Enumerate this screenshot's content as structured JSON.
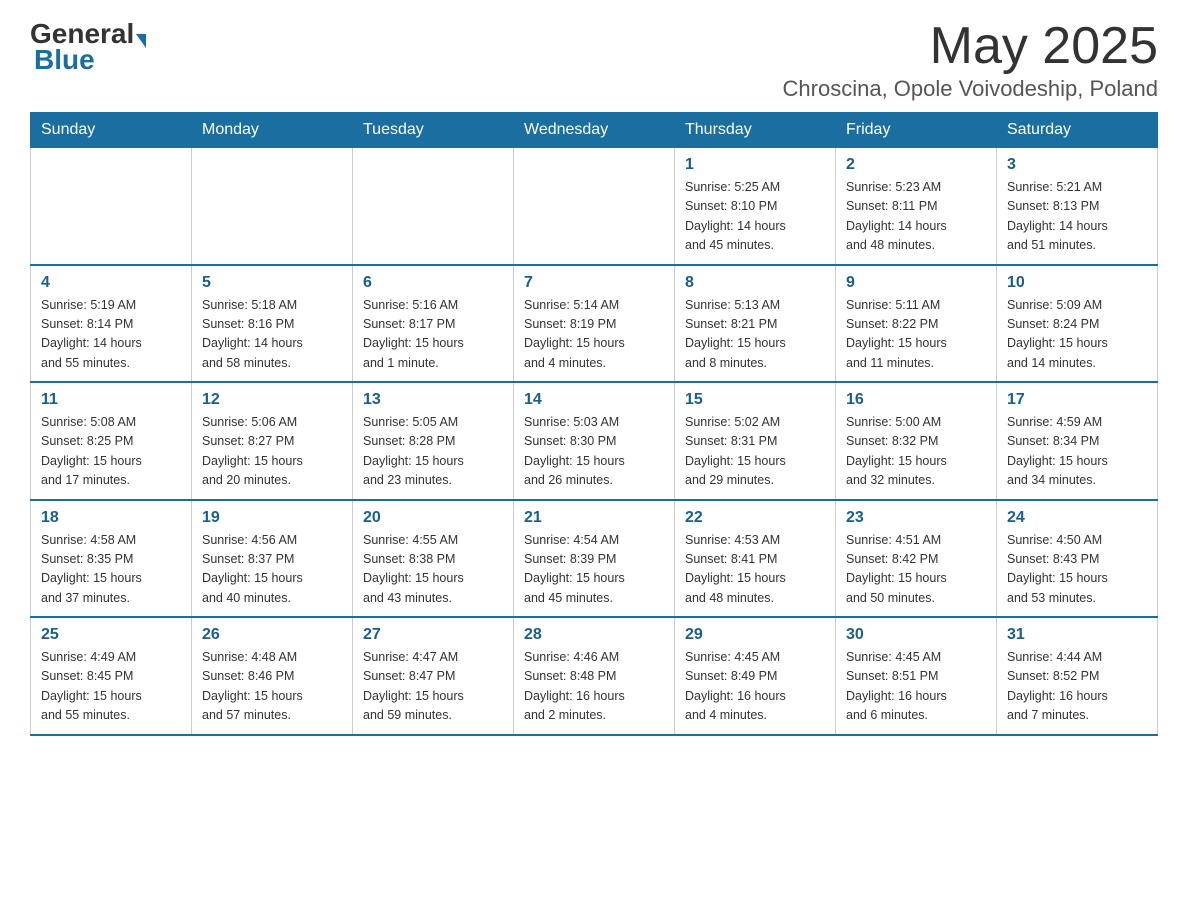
{
  "header": {
    "logo_general": "General",
    "logo_blue": "Blue",
    "month": "May 2025",
    "location": "Chroscina, Opole Voivodeship, Poland"
  },
  "days_of_week": [
    "Sunday",
    "Monday",
    "Tuesday",
    "Wednesday",
    "Thursday",
    "Friday",
    "Saturday"
  ],
  "weeks": [
    [
      {
        "day": "",
        "info": ""
      },
      {
        "day": "",
        "info": ""
      },
      {
        "day": "",
        "info": ""
      },
      {
        "day": "",
        "info": ""
      },
      {
        "day": "1",
        "info": "Sunrise: 5:25 AM\nSunset: 8:10 PM\nDaylight: 14 hours\nand 45 minutes."
      },
      {
        "day": "2",
        "info": "Sunrise: 5:23 AM\nSunset: 8:11 PM\nDaylight: 14 hours\nand 48 minutes."
      },
      {
        "day": "3",
        "info": "Sunrise: 5:21 AM\nSunset: 8:13 PM\nDaylight: 14 hours\nand 51 minutes."
      }
    ],
    [
      {
        "day": "4",
        "info": "Sunrise: 5:19 AM\nSunset: 8:14 PM\nDaylight: 14 hours\nand 55 minutes."
      },
      {
        "day": "5",
        "info": "Sunrise: 5:18 AM\nSunset: 8:16 PM\nDaylight: 14 hours\nand 58 minutes."
      },
      {
        "day": "6",
        "info": "Sunrise: 5:16 AM\nSunset: 8:17 PM\nDaylight: 15 hours\nand 1 minute."
      },
      {
        "day": "7",
        "info": "Sunrise: 5:14 AM\nSunset: 8:19 PM\nDaylight: 15 hours\nand 4 minutes."
      },
      {
        "day": "8",
        "info": "Sunrise: 5:13 AM\nSunset: 8:21 PM\nDaylight: 15 hours\nand 8 minutes."
      },
      {
        "day": "9",
        "info": "Sunrise: 5:11 AM\nSunset: 8:22 PM\nDaylight: 15 hours\nand 11 minutes."
      },
      {
        "day": "10",
        "info": "Sunrise: 5:09 AM\nSunset: 8:24 PM\nDaylight: 15 hours\nand 14 minutes."
      }
    ],
    [
      {
        "day": "11",
        "info": "Sunrise: 5:08 AM\nSunset: 8:25 PM\nDaylight: 15 hours\nand 17 minutes."
      },
      {
        "day": "12",
        "info": "Sunrise: 5:06 AM\nSunset: 8:27 PM\nDaylight: 15 hours\nand 20 minutes."
      },
      {
        "day": "13",
        "info": "Sunrise: 5:05 AM\nSunset: 8:28 PM\nDaylight: 15 hours\nand 23 minutes."
      },
      {
        "day": "14",
        "info": "Sunrise: 5:03 AM\nSunset: 8:30 PM\nDaylight: 15 hours\nand 26 minutes."
      },
      {
        "day": "15",
        "info": "Sunrise: 5:02 AM\nSunset: 8:31 PM\nDaylight: 15 hours\nand 29 minutes."
      },
      {
        "day": "16",
        "info": "Sunrise: 5:00 AM\nSunset: 8:32 PM\nDaylight: 15 hours\nand 32 minutes."
      },
      {
        "day": "17",
        "info": "Sunrise: 4:59 AM\nSunset: 8:34 PM\nDaylight: 15 hours\nand 34 minutes."
      }
    ],
    [
      {
        "day": "18",
        "info": "Sunrise: 4:58 AM\nSunset: 8:35 PM\nDaylight: 15 hours\nand 37 minutes."
      },
      {
        "day": "19",
        "info": "Sunrise: 4:56 AM\nSunset: 8:37 PM\nDaylight: 15 hours\nand 40 minutes."
      },
      {
        "day": "20",
        "info": "Sunrise: 4:55 AM\nSunset: 8:38 PM\nDaylight: 15 hours\nand 43 minutes."
      },
      {
        "day": "21",
        "info": "Sunrise: 4:54 AM\nSunset: 8:39 PM\nDaylight: 15 hours\nand 45 minutes."
      },
      {
        "day": "22",
        "info": "Sunrise: 4:53 AM\nSunset: 8:41 PM\nDaylight: 15 hours\nand 48 minutes."
      },
      {
        "day": "23",
        "info": "Sunrise: 4:51 AM\nSunset: 8:42 PM\nDaylight: 15 hours\nand 50 minutes."
      },
      {
        "day": "24",
        "info": "Sunrise: 4:50 AM\nSunset: 8:43 PM\nDaylight: 15 hours\nand 53 minutes."
      }
    ],
    [
      {
        "day": "25",
        "info": "Sunrise: 4:49 AM\nSunset: 8:45 PM\nDaylight: 15 hours\nand 55 minutes."
      },
      {
        "day": "26",
        "info": "Sunrise: 4:48 AM\nSunset: 8:46 PM\nDaylight: 15 hours\nand 57 minutes."
      },
      {
        "day": "27",
        "info": "Sunrise: 4:47 AM\nSunset: 8:47 PM\nDaylight: 15 hours\nand 59 minutes."
      },
      {
        "day": "28",
        "info": "Sunrise: 4:46 AM\nSunset: 8:48 PM\nDaylight: 16 hours\nand 2 minutes."
      },
      {
        "day": "29",
        "info": "Sunrise: 4:45 AM\nSunset: 8:49 PM\nDaylight: 16 hours\nand 4 minutes."
      },
      {
        "day": "30",
        "info": "Sunrise: 4:45 AM\nSunset: 8:51 PM\nDaylight: 16 hours\nand 6 minutes."
      },
      {
        "day": "31",
        "info": "Sunrise: 4:44 AM\nSunset: 8:52 PM\nDaylight: 16 hours\nand 7 minutes."
      }
    ]
  ]
}
